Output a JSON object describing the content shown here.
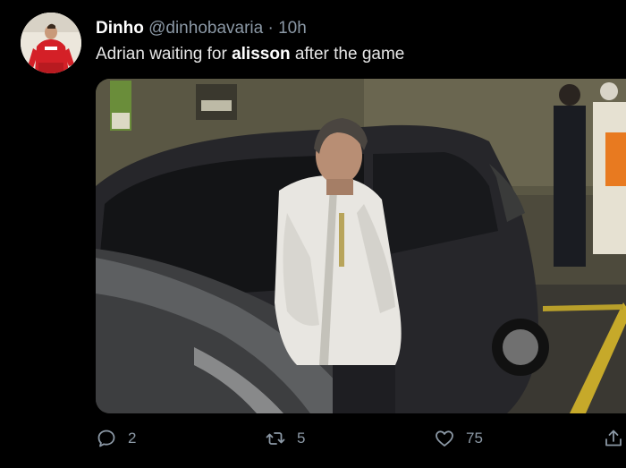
{
  "tweet": {
    "display_name": "Dinho",
    "handle": "@dinhobavaria",
    "separator": "·",
    "time": "10h",
    "text_before": "Adrian waiting for ",
    "text_bold": "alisson",
    "text_after": " after the game",
    "avatar_icon": "user-avatar-red-jersey"
  },
  "actions": {
    "reply_count": "2",
    "retweet_count": "5",
    "like_count": "75"
  },
  "colors": {
    "background": "#000000",
    "secondary_text": "#8b98a5",
    "primary_text": "#ffffff"
  }
}
